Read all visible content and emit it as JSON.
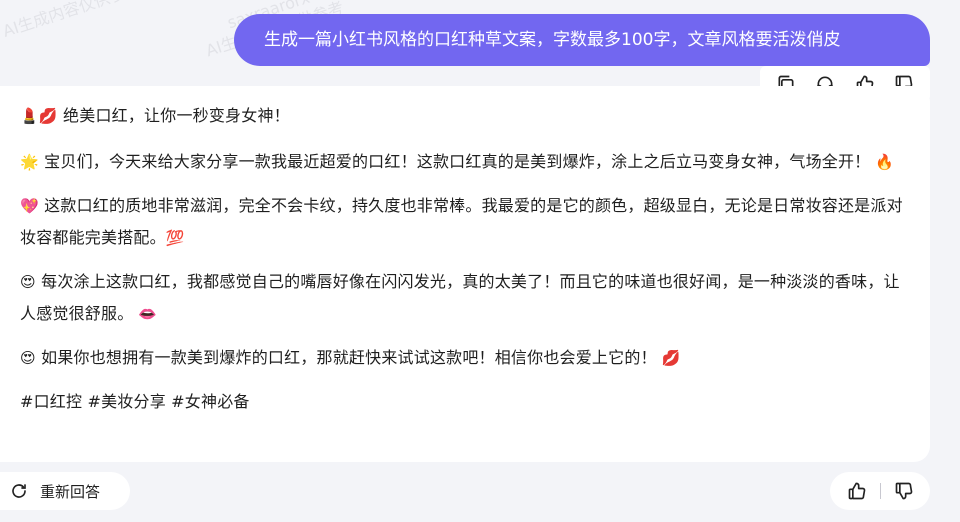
{
  "user_message": "生成一篇小红书风格的口红种草文案，字数最多100字，文章风格要活泼俏皮",
  "message_tools": [
    "copy-icon",
    "headphones-icon",
    "thumbs-up-icon",
    "thumbs-down-icon"
  ],
  "answer": {
    "p1_emoji": "💄💋",
    "p1_text": " 绝美口红，让你一秒变身女神！",
    "p2_emoji": "🌟",
    "p2_text": " 宝贝们，今天来给大家分享一款我最近超爱的口红！这款口红真的是美到爆炸，涂上之后立马变身女神，气场全开！",
    "p2_end": " 🔥",
    "p3_emoji": "💖",
    "p3_text": " 这款口红的质地非常滋润，完全不会卡纹，持久度也非常棒。我最爱的是它的颜色，超级显白，无论是日常妆容还是派对妆容都能完美搭配。",
    "p3_end": "💯",
    "p4_emoji": "😍",
    "p4_text": " 每次涂上这款口红，我都感觉自己的嘴唇好像在闪闪发光，真的太美了！而且它的味道也很好闻，是一种淡淡的香味，让人感觉很舒服。",
    "p4_end": " 👄",
    "p5_emoji": "😍",
    "p5_text": " 如果你也想拥有一款美到爆炸的口红，那就赶快来试试这款吧！相信你也会爱上它的！",
    "p5_end": " 💋",
    "hashtags": "#口红控 #美妆分享 #女神必备"
  },
  "regenerate_label": "重新回答",
  "watermark": {
    "line1": "saxraarorx",
    "line2": "AI生成内容仅供参考"
  },
  "colors": {
    "user_bubble": "#7267f0",
    "background": "#f3f4f8",
    "card": "#ffffff"
  }
}
